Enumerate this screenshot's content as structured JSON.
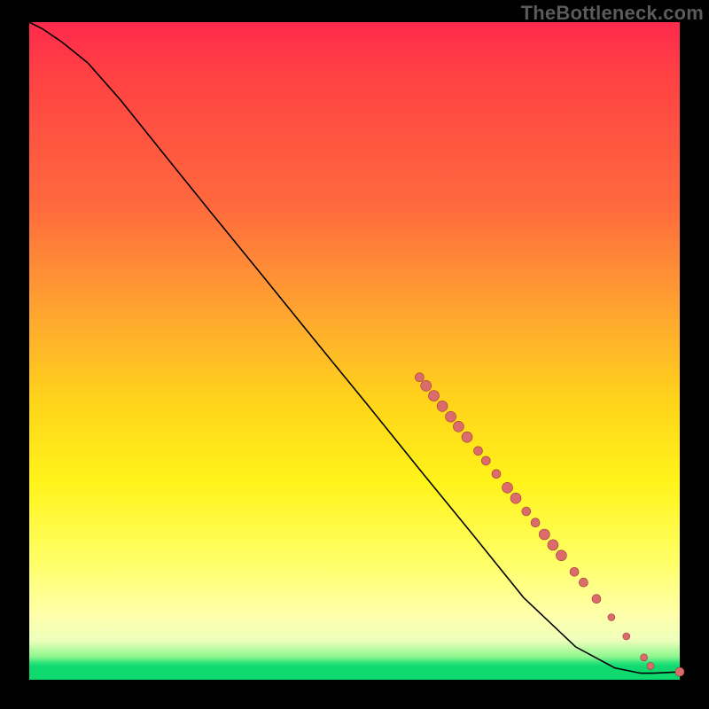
{
  "watermark": "TheBottleneck.com",
  "chart_data": {
    "type": "line",
    "title": "",
    "xlabel": "",
    "ylabel": "",
    "xlim": [
      0,
      1
    ],
    "ylim": [
      0,
      1
    ],
    "curve": [
      {
        "x": 0.0,
        "y": 1.0
      },
      {
        "x": 0.02,
        "y": 0.99
      },
      {
        "x": 0.05,
        "y": 0.97
      },
      {
        "x": 0.09,
        "y": 0.938
      },
      {
        "x": 0.14,
        "y": 0.882
      },
      {
        "x": 0.2,
        "y": 0.808
      },
      {
        "x": 0.28,
        "y": 0.71
      },
      {
        "x": 0.36,
        "y": 0.613
      },
      {
        "x": 0.44,
        "y": 0.515
      },
      {
        "x": 0.52,
        "y": 0.418
      },
      {
        "x": 0.6,
        "y": 0.32
      },
      {
        "x": 0.68,
        "y": 0.223
      },
      {
        "x": 0.76,
        "y": 0.125
      },
      {
        "x": 0.84,
        "y": 0.05
      },
      {
        "x": 0.9,
        "y": 0.018
      },
      {
        "x": 0.94,
        "y": 0.01
      },
      {
        "x": 0.96,
        "y": 0.01
      },
      {
        "x": 1.0,
        "y": 0.012
      }
    ],
    "markers": [
      {
        "x": 0.6,
        "y": 0.46,
        "r": 5
      },
      {
        "x": 0.61,
        "y": 0.447,
        "r": 6
      },
      {
        "x": 0.622,
        "y": 0.432,
        "r": 6
      },
      {
        "x": 0.635,
        "y": 0.416,
        "r": 6
      },
      {
        "x": 0.648,
        "y": 0.4,
        "r": 6
      },
      {
        "x": 0.66,
        "y": 0.385,
        "r": 6
      },
      {
        "x": 0.673,
        "y": 0.369,
        "r": 6
      },
      {
        "x": 0.69,
        "y": 0.348,
        "r": 5
      },
      {
        "x": 0.702,
        "y": 0.333,
        "r": 5
      },
      {
        "x": 0.718,
        "y": 0.313,
        "r": 5
      },
      {
        "x": 0.735,
        "y": 0.292,
        "r": 6
      },
      {
        "x": 0.748,
        "y": 0.276,
        "r": 6
      },
      {
        "x": 0.764,
        "y": 0.256,
        "r": 5
      },
      {
        "x": 0.778,
        "y": 0.239,
        "r": 5
      },
      {
        "x": 0.792,
        "y": 0.221,
        "r": 6
      },
      {
        "x": 0.805,
        "y": 0.205,
        "r": 6
      },
      {
        "x": 0.818,
        "y": 0.189,
        "r": 6
      },
      {
        "x": 0.838,
        "y": 0.164,
        "r": 5
      },
      {
        "x": 0.852,
        "y": 0.148,
        "r": 5
      },
      {
        "x": 0.872,
        "y": 0.123,
        "r": 5
      },
      {
        "x": 0.895,
        "y": 0.095,
        "r": 4
      },
      {
        "x": 0.918,
        "y": 0.066,
        "r": 4
      },
      {
        "x": 0.945,
        "y": 0.034,
        "r": 4
      },
      {
        "x": 0.955,
        "y": 0.021,
        "r": 4
      },
      {
        "x": 1.0,
        "y": 0.012,
        "r": 5
      }
    ],
    "note": "Axes are normalized 0–1; the screenshot exposes no tick labels or units."
  },
  "colors": {
    "marker_fill": "#dc6b6b",
    "marker_stroke": "#9c3a3a",
    "curve": "#000000",
    "watermark": "#5b5b5b"
  }
}
